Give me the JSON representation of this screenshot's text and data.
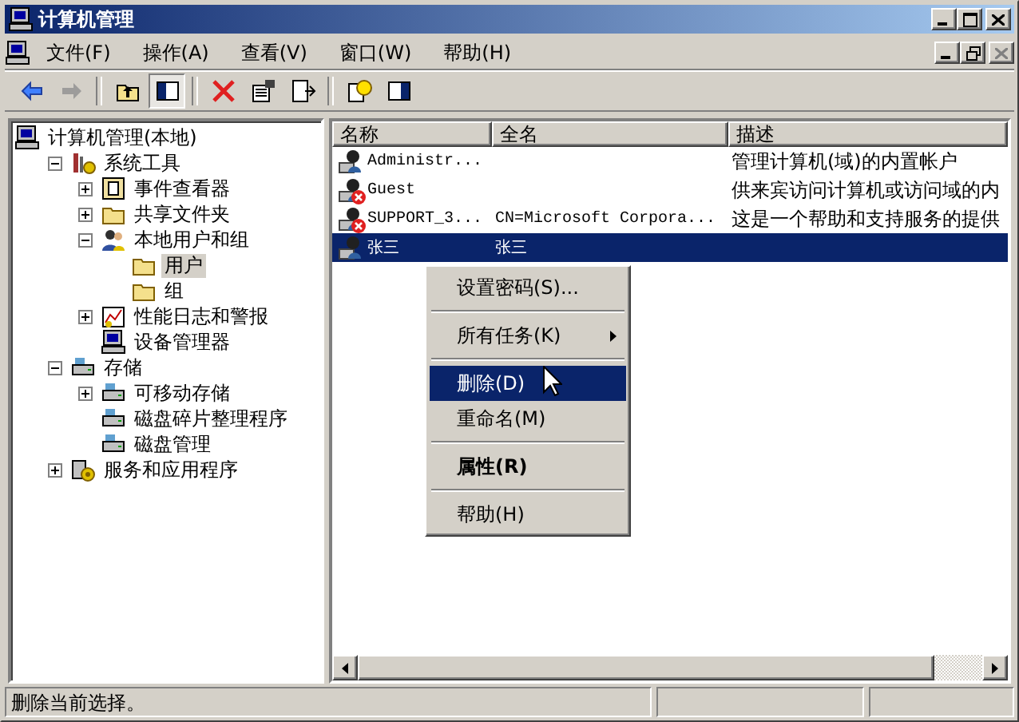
{
  "window": {
    "title": "计算机管理"
  },
  "menu_bar": [
    {
      "label": "文件(F)"
    },
    {
      "label": "操作(A)"
    },
    {
      "label": "查看(V)"
    },
    {
      "label": "窗口(W)"
    },
    {
      "label": "帮助(H)"
    }
  ],
  "toolbar": [
    {
      "kind": "button",
      "disabled": false,
      "pressed": false
    },
    {
      "kind": "button",
      "disabled": true,
      "pressed": false
    },
    {
      "kind": "separator"
    },
    {
      "kind": "button",
      "disabled": false,
      "pressed": false
    },
    {
      "kind": "button",
      "disabled": false,
      "pressed": true
    },
    {
      "kind": "separator"
    },
    {
      "kind": "button",
      "disabled": false,
      "pressed": false
    },
    {
      "kind": "button",
      "disabled": false,
      "pressed": false
    },
    {
      "kind": "button",
      "disabled": false,
      "pressed": false
    },
    {
      "kind": "separator"
    },
    {
      "kind": "button",
      "disabled": false,
      "pressed": false
    },
    {
      "kind": "button",
      "disabled": false,
      "pressed": false
    }
  ],
  "tree": [
    {
      "label": "计算机管理(本地)",
      "selected": false,
      "children": [
        {
          "label": "系统工具",
          "expanded": true,
          "selected": false,
          "children": [
            {
              "label": "事件查看器",
              "expanded": false,
              "selected": false
            },
            {
              "label": "共享文件夹",
              "expanded": false,
              "selected": false
            },
            {
              "label": "本地用户和组",
              "expanded": true,
              "selected": false,
              "children": [
                {
                  "label": "用户",
                  "selected": true
                },
                {
                  "label": "组",
                  "selected": false
                }
              ]
            },
            {
              "label": "性能日志和警报",
              "expanded": false,
              "selected": false
            },
            {
              "label": "设备管理器",
              "selected": false
            }
          ]
        },
        {
          "label": "存储",
          "expanded": true,
          "selected": false,
          "children": [
            {
              "label": "可移动存储",
              "expanded": false,
              "selected": false
            },
            {
              "label": "磁盘碎片整理程序",
              "selected": false
            },
            {
              "label": "磁盘管理",
              "selected": false
            }
          ]
        },
        {
          "label": "服务和应用程序",
          "expanded": false,
          "selected": false
        }
      ]
    }
  ],
  "table": {
    "columns": [
      "名称",
      "全名",
      "描述"
    ],
    "rows": [
      {
        "name": "Administr...",
        "full_name": "",
        "description": "管理计算机(域)的内置帐户",
        "disabled": false,
        "selected": false
      },
      {
        "name": "Guest",
        "full_name": "",
        "description": "供来宾访问计算机或访问域的内",
        "disabled": true,
        "selected": false
      },
      {
        "name": "SUPPORT_3...",
        "full_name": "CN=Microsoft Corpora...",
        "description": "这是一个帮助和支持服务的提供",
        "disabled": true,
        "selected": false
      },
      {
        "name": "张三",
        "full_name": "张三",
        "description": "",
        "disabled": false,
        "selected": true
      }
    ]
  },
  "context_menu": [
    {
      "kind": "item",
      "label": "设置密码(S)...",
      "selected": false,
      "submenu": false,
      "default": false
    },
    {
      "kind": "separator"
    },
    {
      "kind": "item",
      "label": "所有任务(K)",
      "selected": false,
      "submenu": true,
      "default": false
    },
    {
      "kind": "separator"
    },
    {
      "kind": "item",
      "label": "删除(D)",
      "selected": true,
      "submenu": false,
      "default": false
    },
    {
      "kind": "item",
      "label": "重命名(M)",
      "selected": false,
      "submenu": false,
      "default": false
    },
    {
      "kind": "separator"
    },
    {
      "kind": "item",
      "label": "属性(R)",
      "selected": false,
      "submenu": false,
      "default": true
    },
    {
      "kind": "separator"
    },
    {
      "kind": "item",
      "label": "帮助(H)",
      "selected": false,
      "submenu": false,
      "default": false
    }
  ],
  "status_bar": {
    "text": "删除当前选择。"
  }
}
